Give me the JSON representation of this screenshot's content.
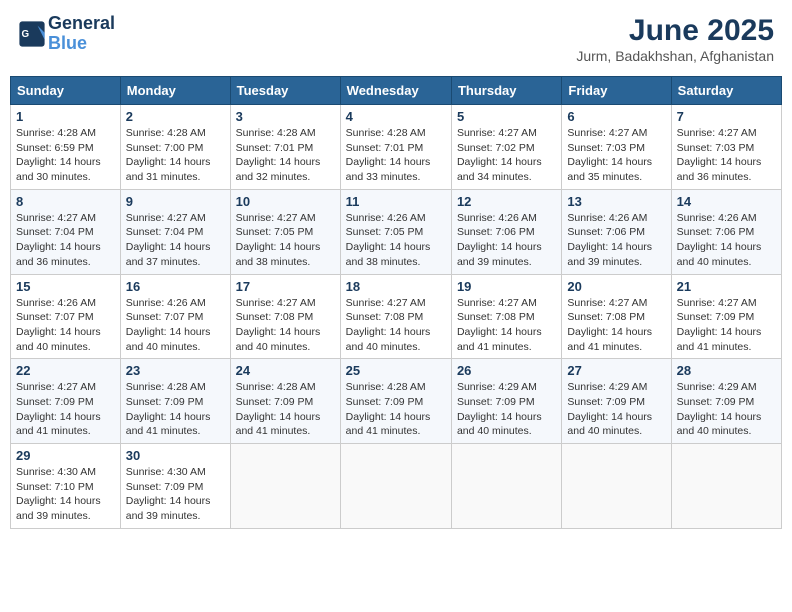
{
  "header": {
    "logo_line1": "General",
    "logo_line2": "Blue",
    "month": "June 2025",
    "location": "Jurm, Badakhshan, Afghanistan"
  },
  "columns": [
    "Sunday",
    "Monday",
    "Tuesday",
    "Wednesday",
    "Thursday",
    "Friday",
    "Saturday"
  ],
  "weeks": [
    [
      {
        "day": "1",
        "sunrise": "4:28 AM",
        "sunset": "6:59 PM",
        "daylight": "14 hours and 30 minutes."
      },
      {
        "day": "2",
        "sunrise": "4:28 AM",
        "sunset": "7:00 PM",
        "daylight": "14 hours and 31 minutes."
      },
      {
        "day": "3",
        "sunrise": "4:28 AM",
        "sunset": "7:01 PM",
        "daylight": "14 hours and 32 minutes."
      },
      {
        "day": "4",
        "sunrise": "4:28 AM",
        "sunset": "7:01 PM",
        "daylight": "14 hours and 33 minutes."
      },
      {
        "day": "5",
        "sunrise": "4:27 AM",
        "sunset": "7:02 PM",
        "daylight": "14 hours and 34 minutes."
      },
      {
        "day": "6",
        "sunrise": "4:27 AM",
        "sunset": "7:03 PM",
        "daylight": "14 hours and 35 minutes."
      },
      {
        "day": "7",
        "sunrise": "4:27 AM",
        "sunset": "7:03 PM",
        "daylight": "14 hours and 36 minutes."
      }
    ],
    [
      {
        "day": "8",
        "sunrise": "4:27 AM",
        "sunset": "7:04 PM",
        "daylight": "14 hours and 36 minutes."
      },
      {
        "day": "9",
        "sunrise": "4:27 AM",
        "sunset": "7:04 PM",
        "daylight": "14 hours and 37 minutes."
      },
      {
        "day": "10",
        "sunrise": "4:27 AM",
        "sunset": "7:05 PM",
        "daylight": "14 hours and 38 minutes."
      },
      {
        "day": "11",
        "sunrise": "4:26 AM",
        "sunset": "7:05 PM",
        "daylight": "14 hours and 38 minutes."
      },
      {
        "day": "12",
        "sunrise": "4:26 AM",
        "sunset": "7:06 PM",
        "daylight": "14 hours and 39 minutes."
      },
      {
        "day": "13",
        "sunrise": "4:26 AM",
        "sunset": "7:06 PM",
        "daylight": "14 hours and 39 minutes."
      },
      {
        "day": "14",
        "sunrise": "4:26 AM",
        "sunset": "7:06 PM",
        "daylight": "14 hours and 40 minutes."
      }
    ],
    [
      {
        "day": "15",
        "sunrise": "4:26 AM",
        "sunset": "7:07 PM",
        "daylight": "14 hours and 40 minutes."
      },
      {
        "day": "16",
        "sunrise": "4:26 AM",
        "sunset": "7:07 PM",
        "daylight": "14 hours and 40 minutes."
      },
      {
        "day": "17",
        "sunrise": "4:27 AM",
        "sunset": "7:08 PM",
        "daylight": "14 hours and 40 minutes."
      },
      {
        "day": "18",
        "sunrise": "4:27 AM",
        "sunset": "7:08 PM",
        "daylight": "14 hours and 40 minutes."
      },
      {
        "day": "19",
        "sunrise": "4:27 AM",
        "sunset": "7:08 PM",
        "daylight": "14 hours and 41 minutes."
      },
      {
        "day": "20",
        "sunrise": "4:27 AM",
        "sunset": "7:08 PM",
        "daylight": "14 hours and 41 minutes."
      },
      {
        "day": "21",
        "sunrise": "4:27 AM",
        "sunset": "7:09 PM",
        "daylight": "14 hours and 41 minutes."
      }
    ],
    [
      {
        "day": "22",
        "sunrise": "4:27 AM",
        "sunset": "7:09 PM",
        "daylight": "14 hours and 41 minutes."
      },
      {
        "day": "23",
        "sunrise": "4:28 AM",
        "sunset": "7:09 PM",
        "daylight": "14 hours and 41 minutes."
      },
      {
        "day": "24",
        "sunrise": "4:28 AM",
        "sunset": "7:09 PM",
        "daylight": "14 hours and 41 minutes."
      },
      {
        "day": "25",
        "sunrise": "4:28 AM",
        "sunset": "7:09 PM",
        "daylight": "14 hours and 41 minutes."
      },
      {
        "day": "26",
        "sunrise": "4:29 AM",
        "sunset": "7:09 PM",
        "daylight": "14 hours and 40 minutes."
      },
      {
        "day": "27",
        "sunrise": "4:29 AM",
        "sunset": "7:09 PM",
        "daylight": "14 hours and 40 minutes."
      },
      {
        "day": "28",
        "sunrise": "4:29 AM",
        "sunset": "7:09 PM",
        "daylight": "14 hours and 40 minutes."
      }
    ],
    [
      {
        "day": "29",
        "sunrise": "4:30 AM",
        "sunset": "7:10 PM",
        "daylight": "14 hours and 39 minutes."
      },
      {
        "day": "30",
        "sunrise": "4:30 AM",
        "sunset": "7:09 PM",
        "daylight": "14 hours and 39 minutes."
      },
      null,
      null,
      null,
      null,
      null
    ]
  ],
  "labels": {
    "sunrise_prefix": "Sunrise: ",
    "sunset_prefix": "Sunset: ",
    "daylight_prefix": "Daylight: "
  }
}
